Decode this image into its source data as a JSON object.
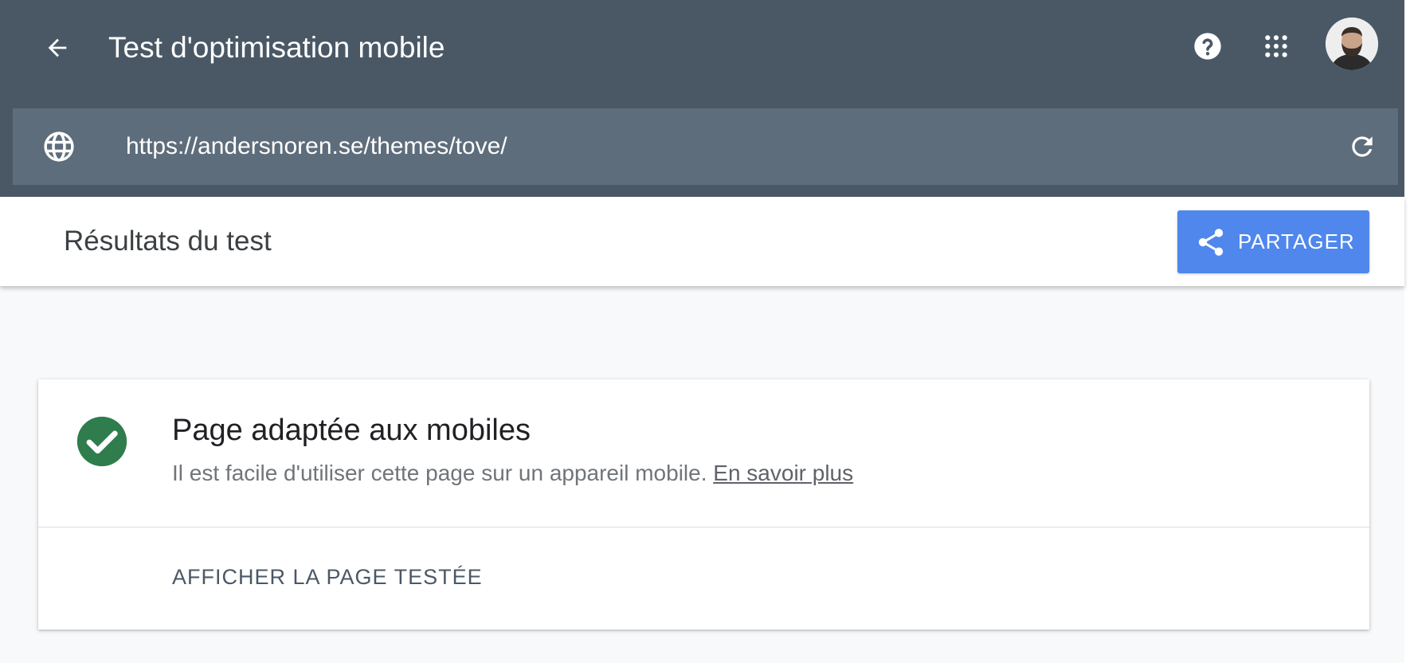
{
  "app": {
    "title": "Test d'optimisation mobile"
  },
  "header": {
    "back_icon": "arrow-left-icon",
    "help_icon": "help-circle-icon",
    "apps_icon": "grid-apps-icon",
    "avatar_icon": "user-avatar"
  },
  "url_bar": {
    "icon": "globe-icon",
    "value": "https://andersnoren.se/themes/tove/",
    "refresh_icon": "refresh-icon"
  },
  "results": {
    "title": "Résultats du test",
    "share_label": "PARTAGER",
    "share_icon": "share-icon"
  },
  "result_card": {
    "status_icon": "check-circle-icon",
    "title": "Page adaptée aux mobiles",
    "description": "Il est facile d'utiliser cette page sur un appareil mobile.",
    "learn_more": "En savoir plus",
    "view_page_label": "AFFICHER LA PAGE TESTÉE"
  },
  "colors": {
    "header_bg": "#4a5866",
    "url_bar_bg": "#5e6d7b",
    "share_button": "#4f87ec",
    "success": "#2f7d4c",
    "page_bg": "#f8f9fa"
  }
}
